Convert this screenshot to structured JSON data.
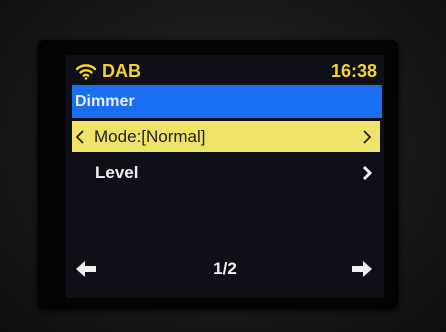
{
  "status": {
    "source": "DAB",
    "time": "16:38",
    "source_icon": "wifi-icon"
  },
  "menu": {
    "title": "Dimmer",
    "items": [
      {
        "label": "Mode:[Normal]",
        "selected": true
      },
      {
        "label": "Level",
        "selected": false
      }
    ]
  },
  "footer": {
    "page": "1/2",
    "left_icon": "arrow-left-icon",
    "right_icon": "arrow-right-icon"
  },
  "colors": {
    "status_text": "#f3d42a",
    "title_bar": "#1a6ef0",
    "selected_item": "#f0e36a",
    "screen_bg": "#0f0f17"
  }
}
